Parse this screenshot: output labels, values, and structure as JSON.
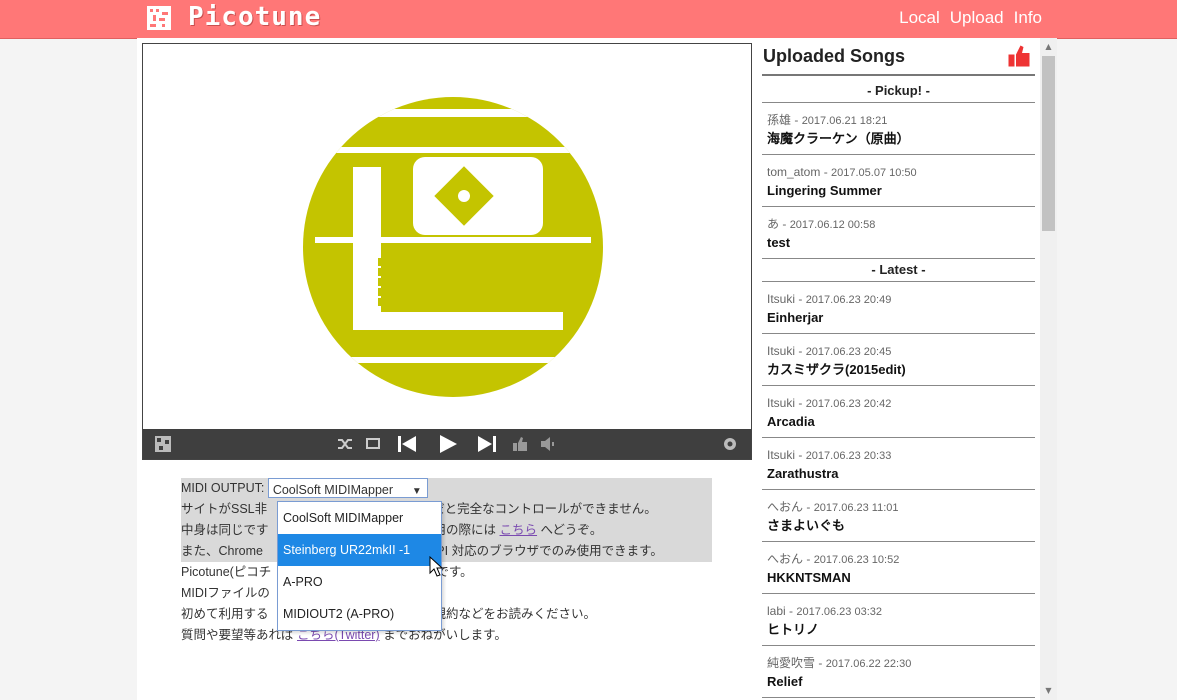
{
  "brand": {
    "name": "Picotune"
  },
  "nav": [
    "Local",
    "Upload",
    "Info"
  ],
  "midi": {
    "label": "MIDI OUTPUT:",
    "selected": "CoolSoft MIDIMapper",
    "options": [
      "CoolSoft MIDIMapper",
      "Steinberg UR22mkII -1",
      "A-PRO",
      "MIDIOUT2 (A-PRO)"
    ]
  },
  "info": {
    "line1": "サイトがSSL非",
    "line1b": "だと完全なコントロールができません。",
    "line2": "中身は同じです",
    "line2b": "用の際には",
    "line2_link": "こちら",
    "line2c": "へどうぞ。",
    "line3": "また、Chrome",
    "line3b": "API 対応のブラウザでのみ使用できます。",
    "line4": "Picotune(ピコチ",
    "line4b": "です。",
    "line5": "MIDIファイルの",
    "line6": "初めて利用する",
    "line6b": "規約などをお読みください。",
    "line7": "質問や要望等あれば",
    "line7_link": "こちら(Twitter)",
    "line7b": "までおねがいします。"
  },
  "sidebar": {
    "title": "Uploaded Songs",
    "pickup_label": "- Pickup! -",
    "latest_label": "- Latest -",
    "pickup": [
      {
        "user": "孫雄",
        "date": "2017.06.21 18:21",
        "title": "海魔クラーケン（原曲）"
      },
      {
        "user": "tom_atom",
        "date": "2017.05.07 10:50",
        "title": "Lingering Summer"
      },
      {
        "user": "あ",
        "date": "2017.06.12 00:58",
        "title": "test"
      }
    ],
    "latest": [
      {
        "user": "Itsuki",
        "date": "2017.06.23 20:49",
        "title": "Einherjar"
      },
      {
        "user": "Itsuki",
        "date": "2017.06.23 20:45",
        "title": "カスミザクラ(2015edit)"
      },
      {
        "user": "Itsuki",
        "date": "2017.06.23 20:42",
        "title": "Arcadia"
      },
      {
        "user": "Itsuki",
        "date": "2017.06.23 20:33",
        "title": "Zarathustra"
      },
      {
        "user": "へおん",
        "date": "2017.06.23 11:01",
        "title": "さまよいぐも"
      },
      {
        "user": "へおん",
        "date": "2017.06.23 10:52",
        "title": "HKKNTSMAN"
      },
      {
        "user": "labi",
        "date": "2017.06.23 03:32",
        "title": "ヒトリノ"
      },
      {
        "user": "純愛吹雪",
        "date": "2017.06.22 22:30",
        "title": "Relief"
      }
    ]
  },
  "colors": {
    "topbar": "#ff7777",
    "art": "#c4c400",
    "controls": "#3f3f3f",
    "selected_option": "#1e88e5"
  },
  "icons": [
    "picotune-logo-icon",
    "shuffle-icon",
    "repeat-icon",
    "previous-icon",
    "play-icon",
    "next-icon",
    "like-icon",
    "volume-icon",
    "settings-icon"
  ]
}
